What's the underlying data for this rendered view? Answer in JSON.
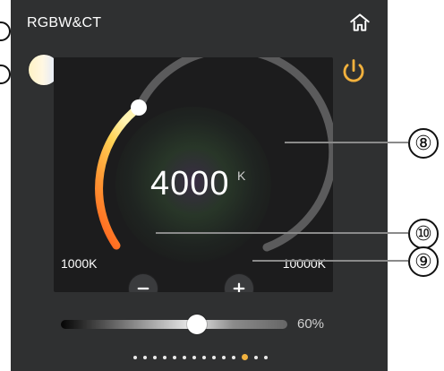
{
  "header": {
    "title": "RGBW&CT"
  },
  "icons": {
    "home": "home-icon",
    "power": "power-icon",
    "minus": "minus-icon",
    "plus": "plus-icon"
  },
  "colors": {
    "panel_bg": "#2f3031",
    "card_bg": "#1c1c1d",
    "accent_orange": "#f1b23f",
    "power_orange": "#f2b13d"
  },
  "controls": {
    "color_temperature": {
      "value": "4000",
      "unit": "K",
      "min_label": "1000K",
      "max_label": "10000K",
      "numeric_value": 4000,
      "min": 1000,
      "max": 10000
    },
    "brightness": {
      "value": 60,
      "label": "60%"
    },
    "page_indicator": {
      "total": 14,
      "active_index": 11
    }
  },
  "annotations": {
    "dial": "⑧",
    "minus": "⑩",
    "plus": "⑨"
  }
}
